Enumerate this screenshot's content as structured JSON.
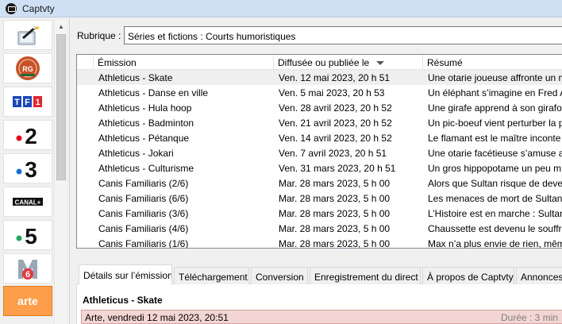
{
  "window": {
    "title": "Captvty"
  },
  "sidebar": {
    "channels": [
      {
        "name": "tools",
        "label": ""
      },
      {
        "name": "roland-garros",
        "label": "ROLAND GARROS"
      },
      {
        "name": "tf1",
        "label": "TF1"
      },
      {
        "name": "france-2",
        "label": "2"
      },
      {
        "name": "france-3",
        "label": "3"
      },
      {
        "name": "canal-plus",
        "label": "CANAL+"
      },
      {
        "name": "france-5",
        "label": "5"
      },
      {
        "name": "m6",
        "label": "M6"
      },
      {
        "name": "arte",
        "label": "arte"
      }
    ],
    "selected": "arte"
  },
  "rubrique": {
    "label": "Rubrique :",
    "value": "Séries et fictions : Courts humoristiques"
  },
  "list": {
    "columns": [
      "Émission",
      "Diffusée ou publiée le",
      "Résumé"
    ],
    "rows": [
      [
        "Athleticus - Skate",
        "Ven. 12 mai 2023, 20 h 51",
        "Une otarie joueuse affronte un m"
      ],
      [
        "Athleticus - Danse en ville",
        "Ven. 5 mai 2023, 20 h 53",
        "Un éléphant s’imagine en Fred A"
      ],
      [
        "Athleticus - Hula hoop",
        "Ven. 28 avril 2023, 20 h 52",
        "Une girafe apprend à son girafor"
      ],
      [
        "Athleticus - Badminton",
        "Ven. 21 avril 2023, 20 h 52",
        "Un pic-boeuf vient perturber la p"
      ],
      [
        "Athleticus - Pétanque",
        "Ven. 14 avril 2023, 20 h 52",
        "Le flamant est le maître inconte"
      ],
      [
        "Athleticus - Jokari",
        "Ven. 7 avril 2023, 20 h 51",
        "Une otarie facétieuse s’amuse av"
      ],
      [
        "Athleticus - Culturisme",
        "Ven. 31 mars 2023, 20 h 51",
        "Un gros hippopotame un peu m"
      ],
      [
        "Canis Familiaris (2/6)",
        "Mar. 28 mars 2023, 5 h 00",
        "Alors que Sultan risque de dever"
      ],
      [
        "Canis Familiaris (6/6)",
        "Mar. 28 mars 2023, 5 h 00",
        "Les menaces de mort de Sultan p"
      ],
      [
        "Canis Familiaris (3/6)",
        "Mar. 28 mars 2023, 5 h 00",
        "L’Histoire est en marche : Sultan"
      ],
      [
        "Canis Familiaris (4/6)",
        "Mar. 28 mars 2023, 5 h 00",
        "Chaussette est devenu le souffre"
      ],
      [
        "Canis Familiaris (1/6)",
        "Mar. 28 mars 2023, 5 h 00",
        "Max n’a plus envie de rien, mêm"
      ]
    ]
  },
  "tabs": [
    "Détails sur l’émission",
    "Téléchargement",
    "Conversion",
    "Enregistrement du direct",
    "À propos de Captvty",
    "Annonces"
  ],
  "details": {
    "title": "Athleticus - Skate",
    "broadcast": "Arte, vendredi 12 mai 2023, 20:51",
    "duration": "Durée : 3 min"
  },
  "colors": {
    "selected_channel": "#ff9e4a",
    "broadcast_bar": "#f3d6d4",
    "titlebar": "#cfe0f4"
  }
}
